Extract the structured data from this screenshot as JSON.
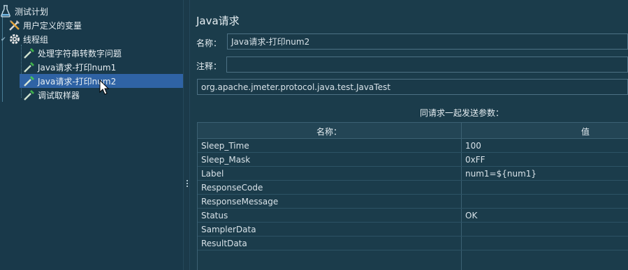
{
  "tree": {
    "items": [
      {
        "label": "测试计划",
        "icon": "test-plan-icon"
      },
      {
        "label": "用户定义的变量",
        "icon": "tools-icon"
      },
      {
        "label": "线程组",
        "icon": "gear-icon"
      },
      {
        "label": "处理字符串转数字问题",
        "icon": "dropper-icon"
      },
      {
        "label": "Java请求-打印num1",
        "icon": "dropper-icon"
      },
      {
        "label": "Java请求-打印num2",
        "icon": "dropper-icon"
      },
      {
        "label": "调试取样器",
        "icon": "dropper-icon"
      }
    ],
    "selected_index": 5
  },
  "panel": {
    "title": "Java请求",
    "name_label": "名称：",
    "name_value": "Java请求-打印num2",
    "comment_label": "注释：",
    "comment_value": "",
    "classname_value": "org.apache.jmeter.protocol.java.test.JavaTest",
    "params_title": "同请求一起发送参数："
  },
  "table": {
    "headers": [
      "名称：",
      "值"
    ],
    "rows": [
      {
        "name": "Sleep_Time",
        "value": "100"
      },
      {
        "name": "Sleep_Mask",
        "value": "0xFF"
      },
      {
        "name": "Label",
        "value": "num1=${num1}"
      },
      {
        "name": "ResponseCode",
        "value": ""
      },
      {
        "name": "ResponseMessage",
        "value": ""
      },
      {
        "name": "Status",
        "value": "OK"
      },
      {
        "name": "SamplerData",
        "value": ""
      },
      {
        "name": "ResultData",
        "value": ""
      }
    ]
  },
  "colors": {
    "background": "#1c3b4a",
    "selection": "#2f63a5",
    "border": "#4d7184"
  }
}
